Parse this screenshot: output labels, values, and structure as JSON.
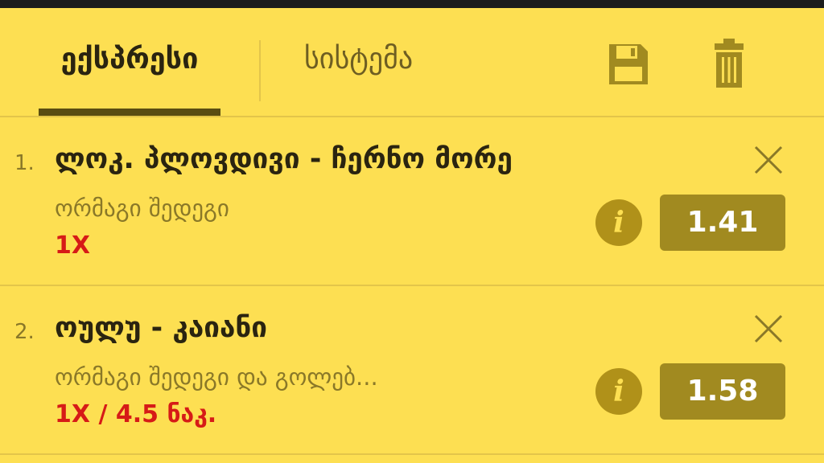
{
  "tabs": [
    {
      "label": "ექსპრესი",
      "active": true
    },
    {
      "label": "სისტემა",
      "active": false
    }
  ],
  "toolbar": {
    "save_icon": "save-icon",
    "trash_icon": "trash-icon"
  },
  "bets": [
    {
      "number": "1.",
      "title": "ლოკ. პლოვდივი - ჩერნო მორე",
      "market": "ორმაგი შედეგი",
      "pick": "1X",
      "odds": "1.41"
    },
    {
      "number": "2.",
      "title": "ოულუ - კაიანი",
      "market": "ორმაგი შედეგი და გოლებ...",
      "pick": "1X / 4.5 ნაკ.",
      "odds": "1.58"
    }
  ],
  "colors": {
    "background": "#FDDF52",
    "accent": "#A18A20",
    "pick": "#D61B17",
    "text": "#2a2410"
  }
}
